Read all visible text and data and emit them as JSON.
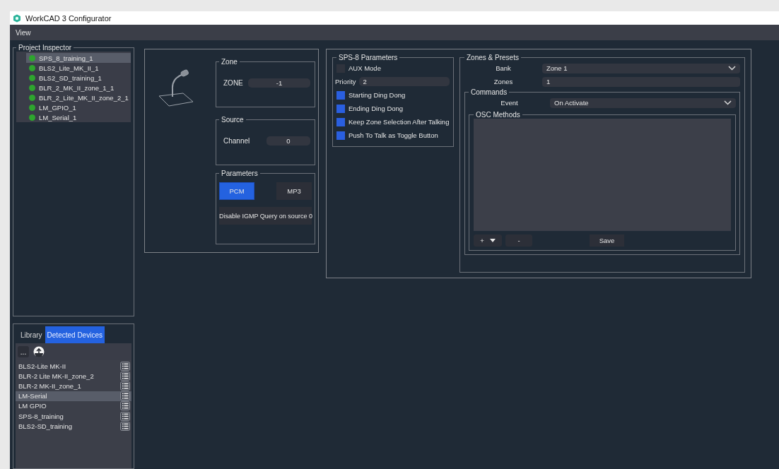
{
  "window": {
    "title": "WorkCAD 3 Configurator"
  },
  "menu": [
    "View"
  ],
  "project_inspector": {
    "title": "Project Inspector",
    "items": [
      {
        "label": "SPS_8_training_1",
        "selected": true
      },
      {
        "label": "BLS2_Lite_MK_II_1",
        "selected": false
      },
      {
        "label": "BLS2_SD_training_1",
        "selected": false
      },
      {
        "label": "BLR_2_MK_II_zone_1_1",
        "selected": false
      },
      {
        "label": "BLR_2_Lite_MK_II_zone_2_1",
        "selected": false
      },
      {
        "label": "LM_GPIO_1",
        "selected": false
      },
      {
        "label": "LM_Serial_1",
        "selected": false
      }
    ]
  },
  "library": {
    "tabs": [
      {
        "label": "Library",
        "selected": false
      },
      {
        "label": "Detected Devices",
        "selected": true
      }
    ],
    "more_button": "...",
    "devices": [
      {
        "label": "BLS2-Lite MK-II",
        "selected": false
      },
      {
        "label": "BLR-2 Lite MK-II_zone_2",
        "selected": false
      },
      {
        "label": "BLR-2 MK-II_zone_1",
        "selected": false
      },
      {
        "label": "LM-Serial",
        "selected": true
      },
      {
        "label": "LM GPIO",
        "selected": false
      },
      {
        "label": "SPS-8_training",
        "selected": false
      },
      {
        "label": "BLS2-SD_training",
        "selected": false
      }
    ]
  },
  "device": {
    "zone": {
      "title": "Zone",
      "label": "ZONE",
      "value": "-1"
    },
    "source": {
      "title": "Source",
      "label": "Channel",
      "value": "0"
    },
    "parameters": {
      "title": "Parameters",
      "formats": [
        {
          "label": "PCM",
          "selected": true
        },
        {
          "label": "MP3",
          "selected": false
        }
      ],
      "igmp_button": "Disable IGMP Query on source 0"
    }
  },
  "sps8": {
    "title": "SPS-8 Parameters",
    "aux_mode": {
      "label": "AUX Mode",
      "checked": false
    },
    "priority": {
      "label": "Priority",
      "value": "2"
    },
    "options": [
      {
        "label": "Starting Ding Dong",
        "checked": true
      },
      {
        "label": "Ending Ding Dong",
        "checked": true
      },
      {
        "label": "Keep Zone Selection After Talking",
        "checked": true
      },
      {
        "label": "Push To Talk as Toggle Button",
        "checked": true
      }
    ]
  },
  "zones_presets": {
    "title": "Zones & Presets",
    "bank": {
      "label": "Bank",
      "value": "Zone 1"
    },
    "zones": {
      "label": "Zones",
      "value": "1"
    },
    "commands": {
      "title": "Commands",
      "event": {
        "label": "Event",
        "value": "On Activate"
      },
      "osc_methods": {
        "title": "OSC Methods",
        "add_button": "+",
        "remove_button": "-",
        "save_button": "Save"
      }
    }
  }
}
